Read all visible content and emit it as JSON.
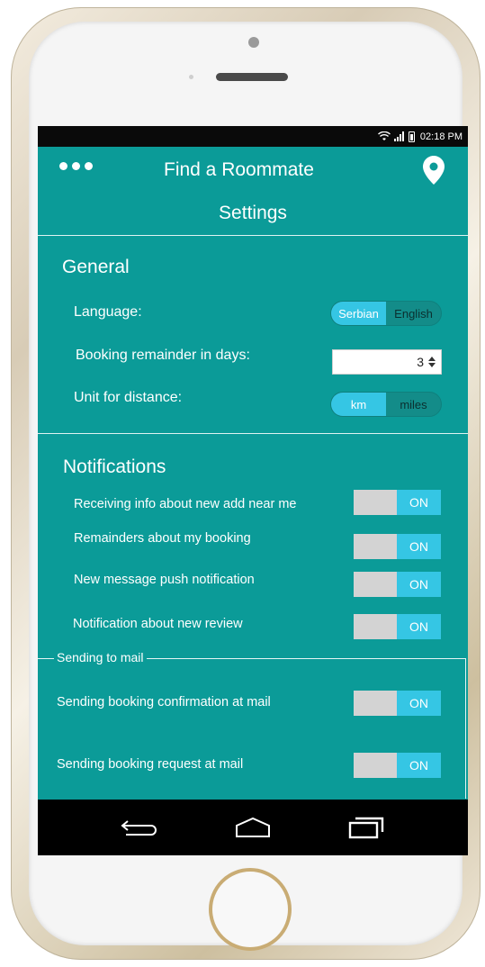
{
  "status_bar": {
    "time": "02:18 PM"
  },
  "app_bar": {
    "title": "Find a Roommate"
  },
  "screen_title": "Settings",
  "general": {
    "title": "General",
    "language_label": "Language:",
    "language_options": [
      "Serbian",
      "English"
    ],
    "language_selected": "Serbian",
    "booking_label": "Booking remainder in days:",
    "booking_value": "3",
    "distance_label": "Unit for distance:",
    "distance_options": [
      "km",
      "miles"
    ],
    "distance_selected": "km"
  },
  "notifications": {
    "title": "Notifications",
    "items": [
      {
        "label": "Receiving info about new add near me",
        "state": "ON"
      },
      {
        "label": "Remainders about my booking",
        "state": "ON"
      },
      {
        "label": "New message push notification",
        "state": "ON"
      },
      {
        "label": "Notification about new review",
        "state": "ON"
      }
    ]
  },
  "mail": {
    "legend": "Sending to mail",
    "items": [
      {
        "label": "Sending booking confirmation at mail",
        "state": "ON"
      },
      {
        "label": "Sending booking request at mail",
        "state": "ON"
      }
    ]
  },
  "nav": {
    "icons": [
      "back-icon",
      "home-icon",
      "recent-apps-icon"
    ]
  },
  "colors": {
    "teal": "#0b9b98",
    "accent": "#35c6e4",
    "toggle_off": "#d3d3d3"
  }
}
